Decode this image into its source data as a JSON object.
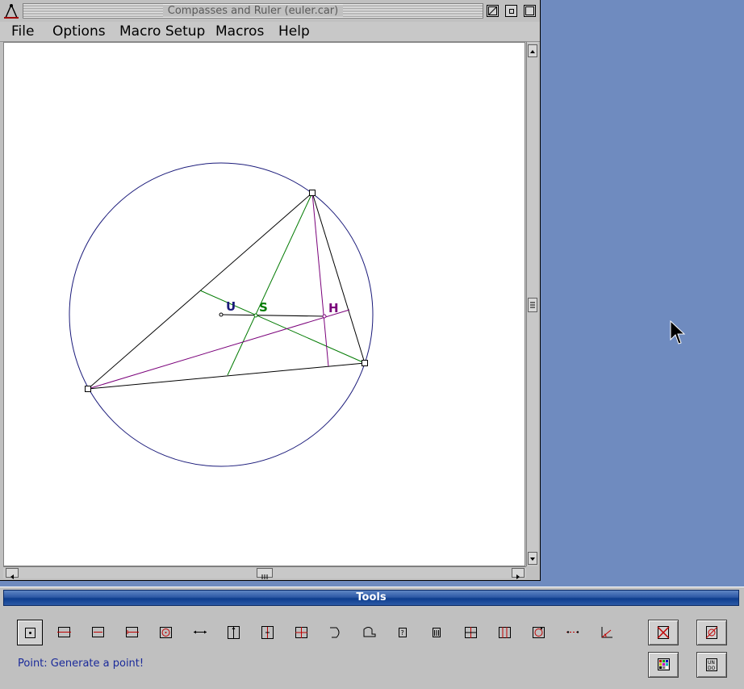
{
  "window": {
    "title": "Compasses and Ruler (euler.car)"
  },
  "menubar": {
    "items": [
      "File",
      "Options",
      "Macro Setup",
      "Macros",
      "Help"
    ]
  },
  "construction": {
    "labels": {
      "U": "U",
      "S": "S",
      "H": "H"
    },
    "colors": {
      "circle": "#1a1a7a",
      "triangle": "#000000",
      "medians": "#007a00",
      "altitudes": "#7a007a",
      "label_u": "#1a1a7a",
      "label_s": "#007a00",
      "label_h": "#7a007a"
    }
  },
  "tools": {
    "title": "Tools",
    "status": "Point: Generate a point!",
    "icons": [
      "point-tool-icon",
      "line-tool-icon",
      "segment-tool-icon",
      "ray-tool-icon",
      "circle-tool-icon",
      "fixed-segment-tool-icon",
      "perpendicular-tool-icon",
      "parallel-tool-icon",
      "intersection-tool-icon",
      "arc-tool-icon",
      "move-tool-icon",
      "hide-tool-icon",
      "delete-tool-icon",
      "midpoint-tool-icon",
      "angle-tool-icon",
      "circle3-tool-icon",
      "dotted-line-tool-icon",
      "measure-angle-tool-icon"
    ],
    "side_buttons": [
      "delete-all-icon",
      "replay-icon",
      "color-icon",
      "undo-icon"
    ]
  }
}
